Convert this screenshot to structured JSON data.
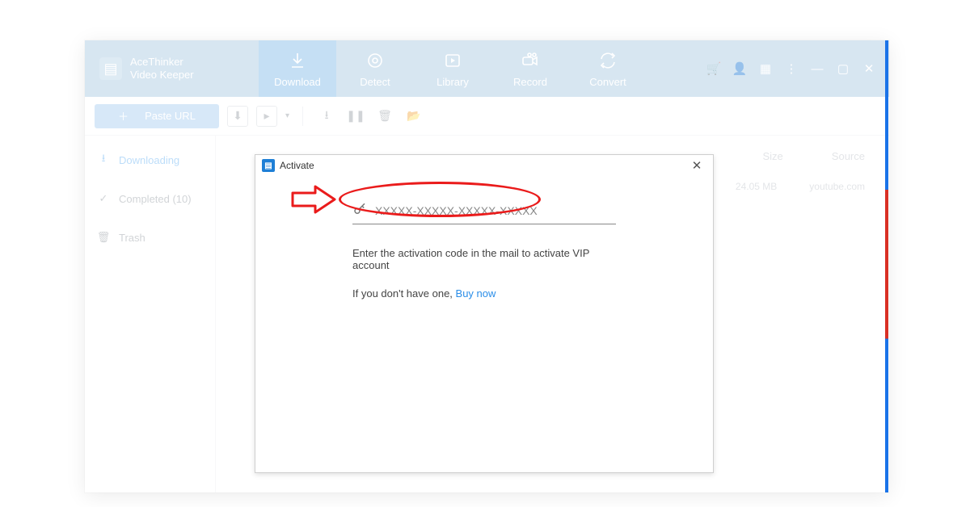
{
  "brand": {
    "line1": "AceThinker",
    "line2": "Video Keeper"
  },
  "tabs": [
    {
      "label": "Download",
      "icon": "download"
    },
    {
      "label": "Detect",
      "icon": "detect"
    },
    {
      "label": "Library",
      "icon": "library"
    },
    {
      "label": "Record",
      "icon": "record"
    },
    {
      "label": "Convert",
      "icon": "convert"
    }
  ],
  "toolbar": {
    "paste_label": "Paste URL"
  },
  "sidebar": {
    "items": [
      {
        "label": "Downloading"
      },
      {
        "label": "Completed (10)"
      },
      {
        "label": "Trash"
      }
    ]
  },
  "columns": {
    "size": "Size",
    "source": "Source"
  },
  "row": {
    "size": "24.05 MB",
    "source": "youtube.com"
  },
  "modal": {
    "title": "Activate",
    "placeholder": "XXXXX-XXXXX-XXXXX-XXXXX",
    "hint": "Enter the activation code in the mail to activate VIP account",
    "nocode_prefix": "If you don't have one, ",
    "buy_label": "Buy now"
  }
}
